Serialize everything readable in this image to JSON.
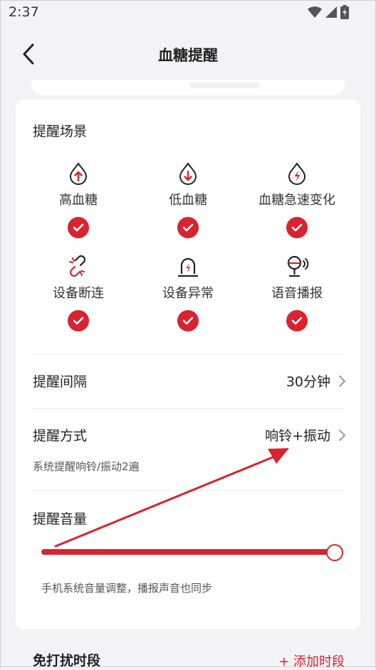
{
  "status_bar": {
    "time": "2:37",
    "icons": [
      "wifi-icon",
      "signal-icon",
      "battery-icon"
    ]
  },
  "nav": {
    "title": "血糖提醒",
    "back_icon": "chevron-left-icon"
  },
  "scenes": {
    "title": "提醒场景",
    "items": [
      {
        "label": "高血糖",
        "icon": "high-glucose-icon",
        "checked": true
      },
      {
        "label": "低血糖",
        "icon": "low-glucose-icon",
        "checked": true
      },
      {
        "label": "血糖急速变化",
        "icon": "rapid-change-icon",
        "checked": true
      },
      {
        "label": "设备断连",
        "icon": "disconnect-icon",
        "checked": true
      },
      {
        "label": "设备异常",
        "icon": "device-alarm-icon",
        "checked": true
      },
      {
        "label": "语音播报",
        "icon": "voice-broadcast-icon",
        "checked": true
      }
    ]
  },
  "interval": {
    "label": "提醒间隔",
    "value": "30分钟"
  },
  "method": {
    "label": "提醒方式",
    "value": "响铃+振动",
    "description": "系统提醒响铃/振动2遍"
  },
  "volume": {
    "label": "提醒音量",
    "level": 1.0,
    "hint": "手机系统音量调整，播报声音也同步"
  },
  "dnd": {
    "title": "免打扰时段",
    "add_label": "+ 添加时段"
  },
  "colors": {
    "accent": "#d9232f",
    "background": "#f3f3f5",
    "card": "#ffffff"
  }
}
